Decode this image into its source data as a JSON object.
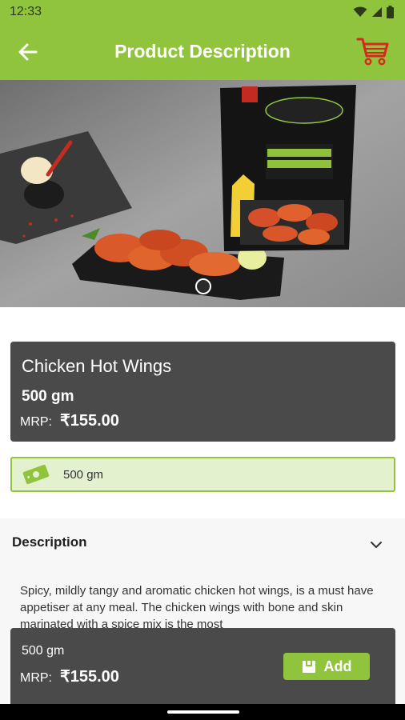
{
  "status_bar": {
    "time": "12:33",
    "icons": [
      "wifi-icon",
      "signal-icon",
      "battery-icon"
    ]
  },
  "app_bar": {
    "title": "Product Description",
    "back_icon": "back-arrow-icon",
    "cart_icon": "cart-icon",
    "background_color": "#90c43d",
    "cart_icon_color": "#d42a1e"
  },
  "hero": {
    "description_icon": "product-image",
    "carousel_pages": 1,
    "carousel_active_page": 1
  },
  "product": {
    "name": "Chicken Hot Wings",
    "weight": "500 gm",
    "mrp_label": "MRP:",
    "price": "₹155.00"
  },
  "variant": {
    "label": "500 gm",
    "icon": "price-tag-icon"
  },
  "description": {
    "title": "Description",
    "expand_icon": "chevron-down-icon",
    "text": "Spicy, mildly tangy and aromatic chicken hot wings, is a must have appetiser at any meal. The chicken wings with bone and skin marinated with a spice mix is the most"
  },
  "bottom_bar": {
    "weight": "500 gm",
    "mrp_label": "MRP:",
    "price": "₹155.00",
    "add_label": "Add",
    "add_icon": "bag-icon"
  },
  "colors": {
    "brand_green": "#90c43d",
    "card_dark": "#4a4a4a",
    "variant_bg": "#e4f1cf"
  }
}
